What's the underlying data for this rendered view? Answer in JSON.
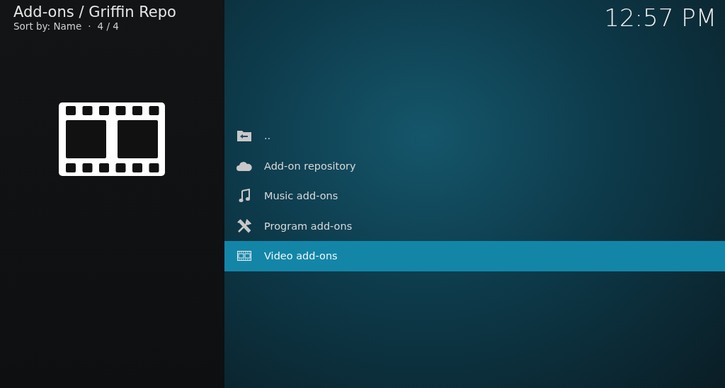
{
  "header": {
    "title": "Add-ons / Griffin Repo",
    "sort_label": "Sort by: Name",
    "separator": "·",
    "count": "4 / 4"
  },
  "clock": "12:57 PM",
  "items": [
    {
      "kind": "parent",
      "label": "..",
      "selected": false
    },
    {
      "kind": "repository",
      "label": "Add-on repository",
      "selected": false
    },
    {
      "kind": "music",
      "label": "Music add-ons",
      "selected": false
    },
    {
      "kind": "program",
      "label": "Program add-ons",
      "selected": false
    },
    {
      "kind": "video",
      "label": "Video add-ons",
      "selected": true
    }
  ]
}
